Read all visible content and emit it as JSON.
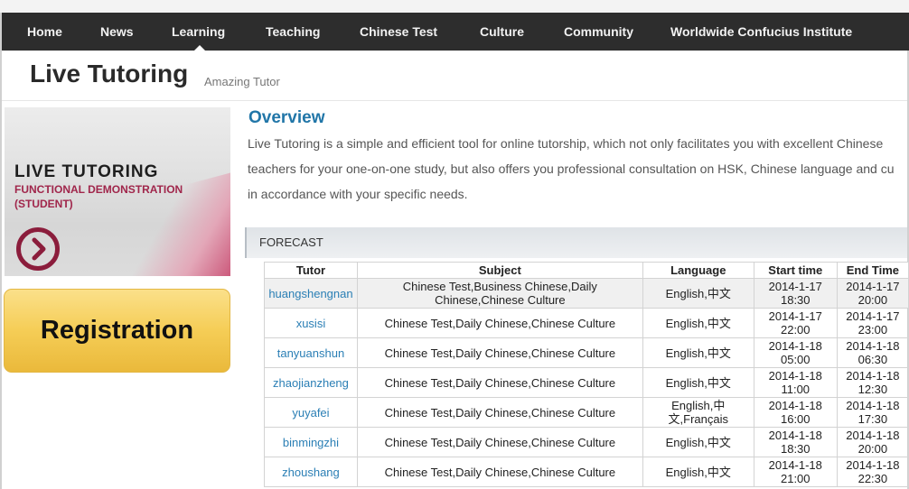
{
  "nav": {
    "items": [
      {
        "label": "Home"
      },
      {
        "label": "News"
      },
      {
        "label": "Learning"
      },
      {
        "label": "Teaching"
      },
      {
        "label": "Chinese Test"
      },
      {
        "label": "Culture"
      },
      {
        "label": "Community"
      },
      {
        "label": "Worldwide Confucius Institute"
      }
    ],
    "active": "Learning"
  },
  "header": {
    "title": "Live Tutoring",
    "subtitle": "Amazing Tutor"
  },
  "promo": {
    "line1": "LIVE TUTORING",
    "line2": "FUNCTIONAL DEMONSTRATION",
    "line3": "(STUDENT)",
    "play_icon": "play-circle-icon"
  },
  "registration": {
    "label": "Registration"
  },
  "overview": {
    "title": "Overview",
    "lines": [
      "Live Tutoring is a simple and efficient tool for online tutorship, which not only facilitates you with excellent Chinese",
      "teachers for your one-on-one study, but also offers you professional consultation on HSK, Chinese language and cu",
      "in accordance with your specific needs."
    ]
  },
  "forecast": {
    "title": "FORECAST",
    "columns": [
      "Tutor",
      "Subject",
      "Language",
      "Start time",
      "End Time"
    ],
    "rows": [
      {
        "tutor": "huangshengnan",
        "subject": "Chinese Test,Business Chinese,Daily Chinese,Chinese Culture",
        "language": "English,中文",
        "start_date": "2014-1-17",
        "start_time": "18:30",
        "end_date": "2014-1-17",
        "end_time": "20:00"
      },
      {
        "tutor": "xusisi",
        "subject": "Chinese Test,Daily Chinese,Chinese Culture",
        "language": "English,中文",
        "start_date": "2014-1-17",
        "start_time": "22:00",
        "end_date": "2014-1-17",
        "end_time": "23:00"
      },
      {
        "tutor": "tanyuanshun",
        "subject": "Chinese Test,Daily Chinese,Chinese Culture",
        "language": "English,中文",
        "start_date": "2014-1-18",
        "start_time": "05:00",
        "end_date": "2014-1-18",
        "end_time": "06:30"
      },
      {
        "tutor": "zhaojianzheng",
        "subject": "Chinese Test,Daily Chinese,Chinese Culture",
        "language": "English,中文",
        "start_date": "2014-1-18",
        "start_time": "11:00",
        "end_date": "2014-1-18",
        "end_time": "12:30"
      },
      {
        "tutor": "yuyafei",
        "subject": "Chinese Test,Daily Chinese,Chinese Culture",
        "language": "English,中文,Français",
        "start_date": "2014-1-18",
        "start_time": "16:00",
        "end_date": "2014-1-18",
        "end_time": "17:30"
      },
      {
        "tutor": "binmingzhi",
        "subject": "Chinese Test,Daily Chinese,Chinese Culture",
        "language": "English,中文",
        "start_date": "2014-1-18",
        "start_time": "18:30",
        "end_date": "2014-1-18",
        "end_time": "20:00"
      },
      {
        "tutor": "zhoushang",
        "subject": "Chinese Test,Daily Chinese,Chinese Culture",
        "language": "English,中文",
        "start_date": "2014-1-18",
        "start_time": "21:00",
        "end_date": "2014-1-18",
        "end_time": "22:30"
      }
    ]
  },
  "colors": {
    "nav_bg": "#2d2d2d",
    "link": "#2b7fb5",
    "heading": "#2176a8",
    "registration_bg": "#f5cd56",
    "accent_red": "#a0264b"
  }
}
